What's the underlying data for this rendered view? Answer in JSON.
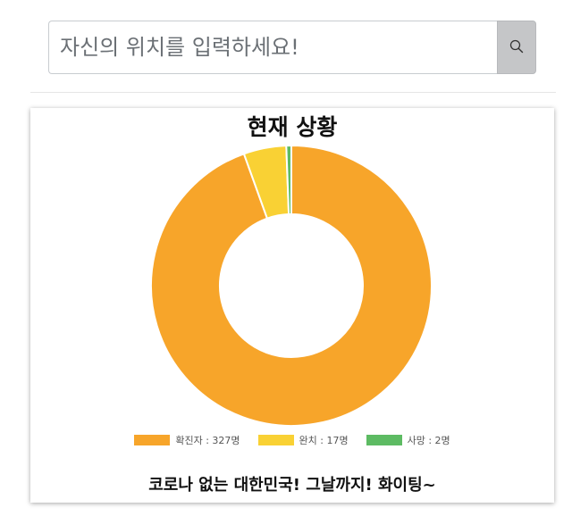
{
  "search": {
    "placeholder": "자신의 위치를 입력하세요!",
    "button_icon": "search-icon"
  },
  "card": {
    "footer": "코로나 없는 대한민국! 그날까지! 화이팅~"
  },
  "chart_data": {
    "type": "pie",
    "variant": "doughnut",
    "title": "현재 상황",
    "categories": [
      "확진자",
      "완치",
      "사망"
    ],
    "values": [
      327,
      17,
      2
    ],
    "unit": "명",
    "colors": [
      "#f7a52a",
      "#f9d134",
      "#5dbb63"
    ],
    "legend_labels": [
      "확진자 : 327명",
      "완치 : 17명",
      "사망 : 2명"
    ],
    "legend_position": "bottom"
  }
}
